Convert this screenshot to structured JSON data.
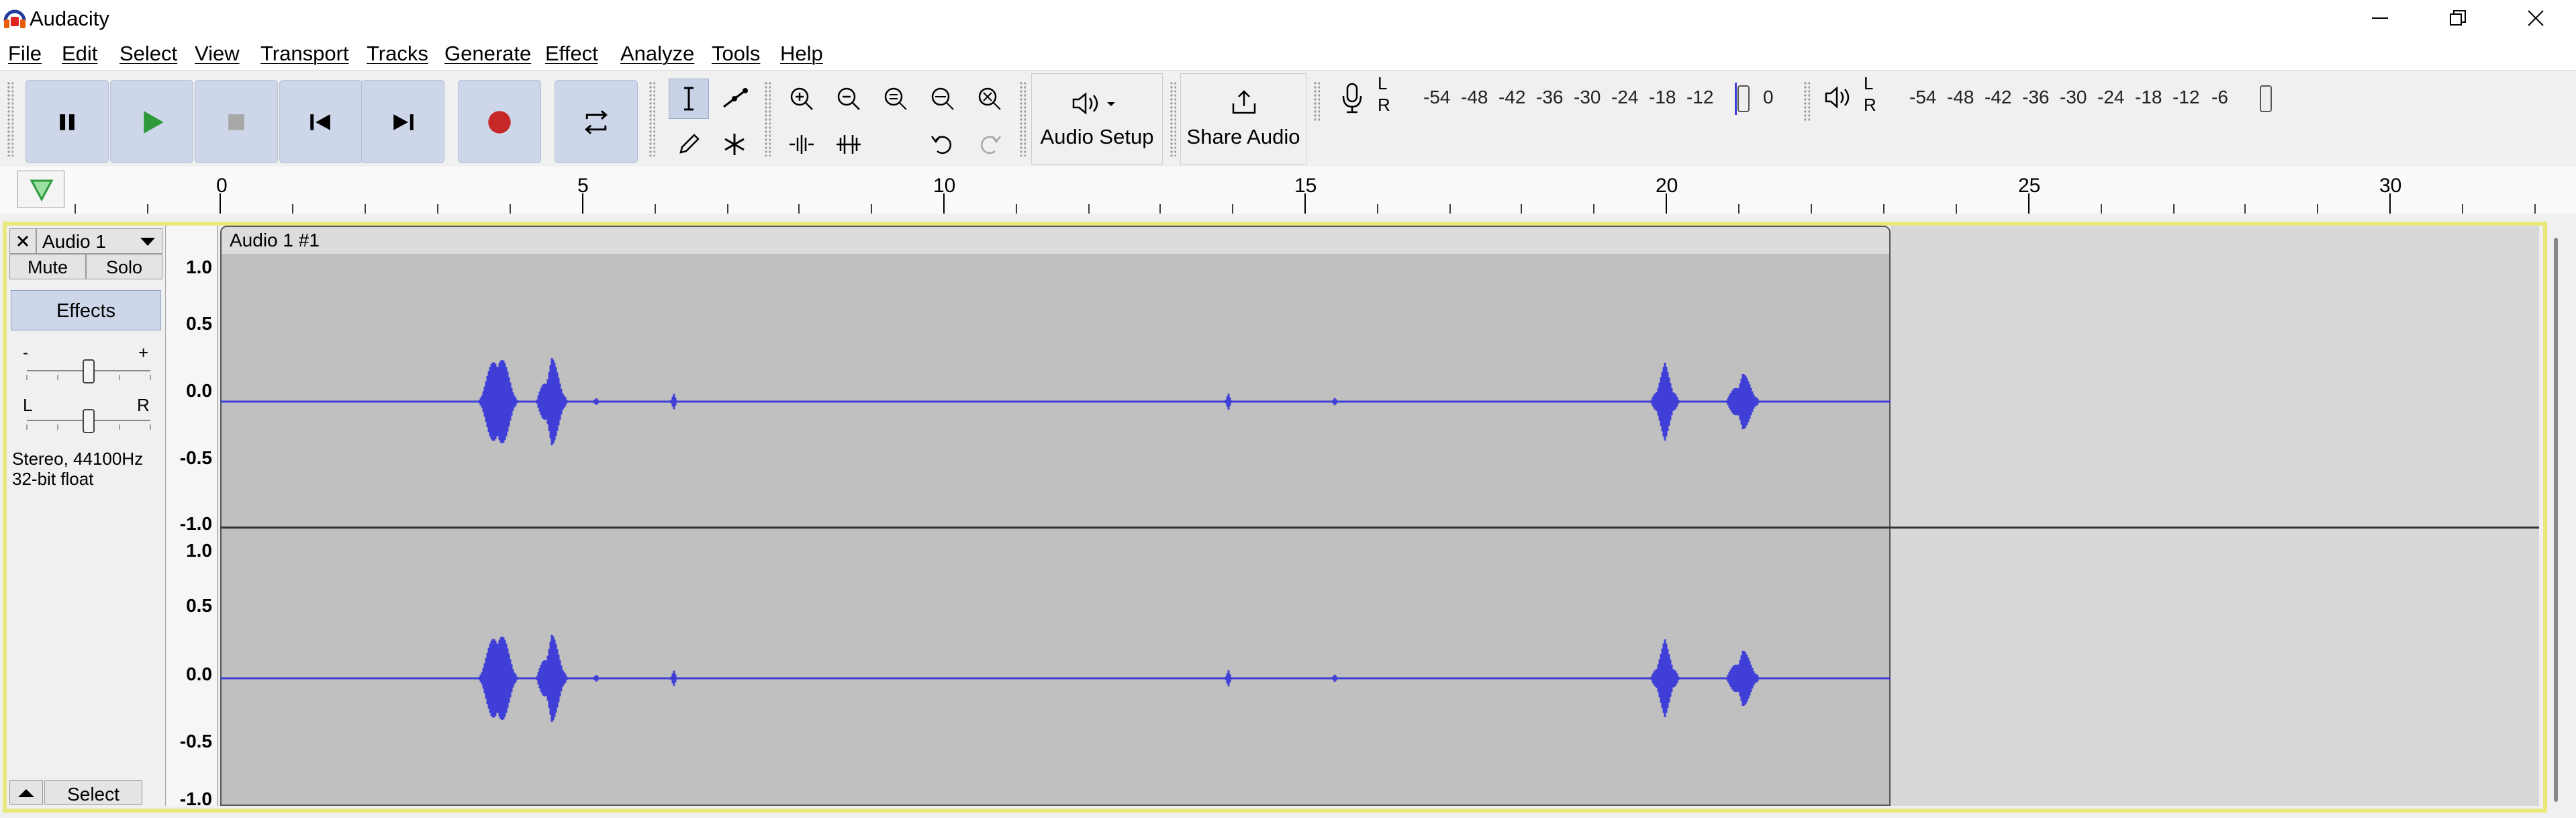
{
  "window": {
    "title": "Audacity",
    "icons": {
      "minimize": "minimize-icon",
      "maximize": "restore-icon",
      "close": "close-icon"
    }
  },
  "menu": [
    "File",
    "Edit",
    "Select",
    "View",
    "Transport",
    "Tracks",
    "Generate",
    "Effect",
    "Analyze",
    "Tools",
    "Help"
  ],
  "toolbar": {
    "transport_icons": [
      "pause-icon",
      "play-icon",
      "stop-icon",
      "skip-start-icon",
      "skip-end-icon",
      "record-icon",
      "loop-icon"
    ],
    "audio_setup_label": "Audio Setup",
    "share_audio_label": "Share Audio",
    "record_meter": {
      "left": "L",
      "right": "R",
      "scale": [
        "-54",
        "-48",
        "-42",
        "-36",
        "-30",
        "-24",
        "-18",
        "-12",
        "0"
      ]
    },
    "play_meter": {
      "left": "L",
      "right": "R",
      "scale": [
        "-54",
        "-48",
        "-42",
        "-36",
        "-30",
        "-24",
        "-18",
        "-12",
        "-6"
      ]
    }
  },
  "timeline": {
    "labels": [
      "0",
      "5",
      "10",
      "15",
      "20",
      "25",
      "30"
    ]
  },
  "track": {
    "name": "Audio 1",
    "mute_label": "Mute",
    "solo_label": "Solo",
    "effects_label": "Effects",
    "gain_minus": "-",
    "gain_plus": "+",
    "pan_left": "L",
    "pan_right": "R",
    "format_line1": "Stereo, 44100Hz",
    "format_line2": "32-bit float",
    "select_label": "Select",
    "clip_name": "Audio 1 #1",
    "vruler_top": [
      "1.0",
      "0.5",
      "0.0",
      "-0.5",
      "-1.0"
    ],
    "vruler_bottom": [
      "1.0",
      "0.5",
      "0.0",
      "-0.5",
      "-1.0"
    ]
  },
  "colors": {
    "waveform": "#3f3fd8",
    "clip_bg": "#c0c0c0",
    "track_highlight": "#e8e87c",
    "button_blue": "#ced7ea",
    "record_red": "#c62828"
  }
}
